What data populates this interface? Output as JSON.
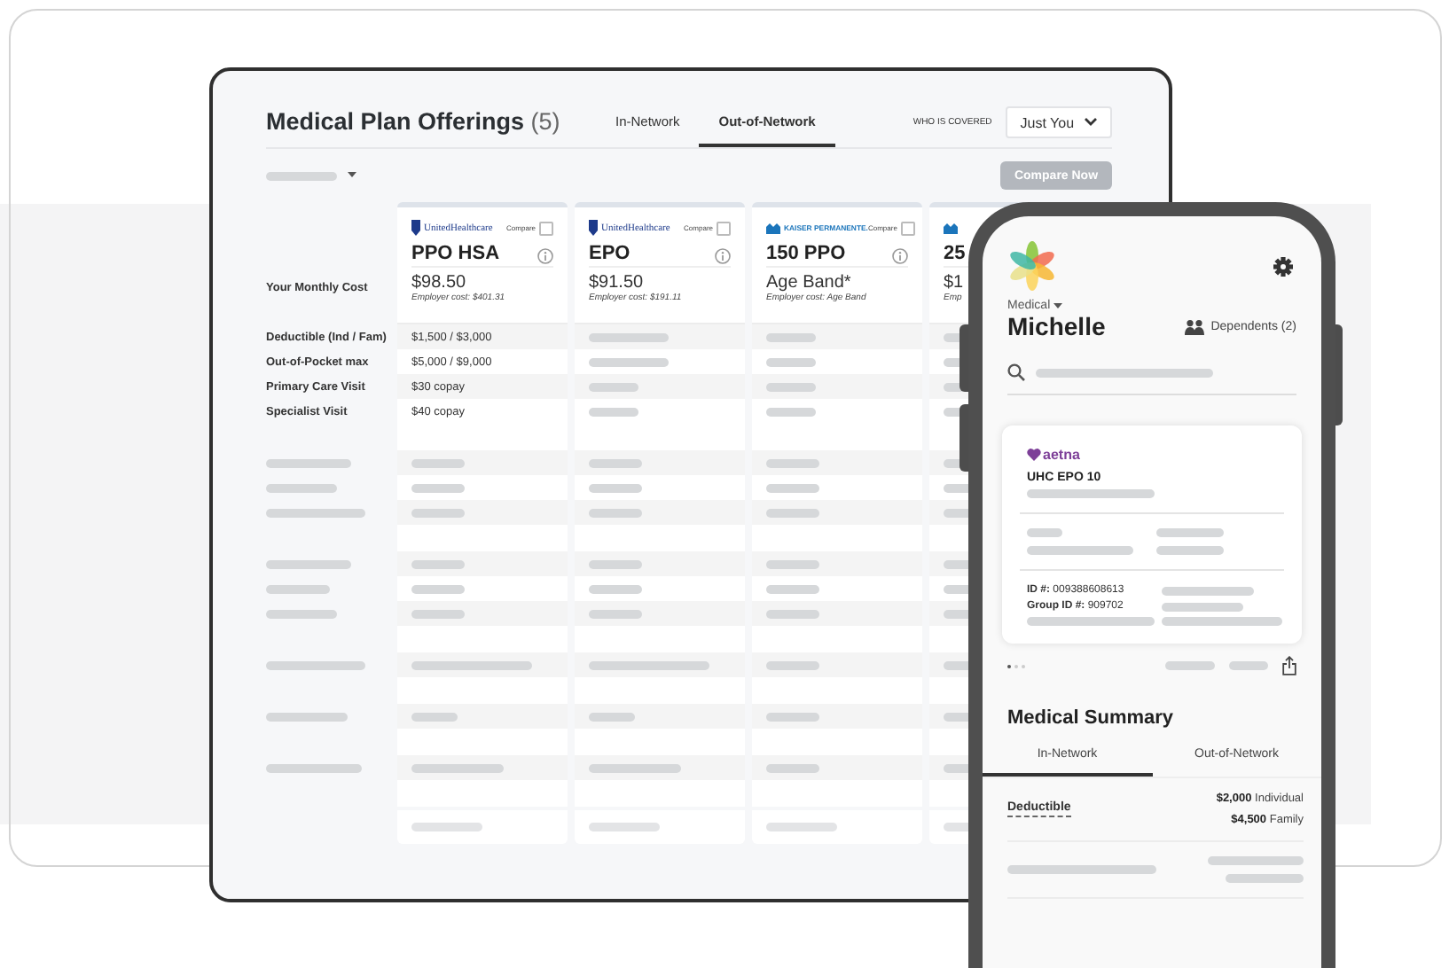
{
  "tablet": {
    "title": "Medical Plan Offerings",
    "count": "(5)",
    "tabs": [
      {
        "label": "In-Network",
        "selected": false
      },
      {
        "label": "Out-of-Network",
        "selected": true
      }
    ],
    "coverage_label": "WHO IS COVERED",
    "coverage_value": "Just You",
    "compare_button": {
      "label": "Compare Now",
      "disabled": true
    },
    "header_label": "Your Monthly Cost",
    "plans": [
      {
        "logo": {
          "kind": "united",
          "text": "UnitedHealthcare"
        },
        "compare_label": "Compare",
        "compare_checked": false,
        "name": "PPO HSA",
        "cost": "$98.50",
        "employer_cost": "Employer cost: $401.31"
      },
      {
        "logo": {
          "kind": "united",
          "text": "UnitedHealthcare"
        },
        "compare_label": "Compare",
        "compare_checked": false,
        "name": "EPO",
        "cost": "$91.50",
        "employer_cost": "Employer cost: $191.11"
      },
      {
        "logo": {
          "kind": "kaiser",
          "text": "KAISER PERMANENTE."
        },
        "compare_label": "Compare",
        "compare_checked": false,
        "name": "150 PPO",
        "cost": "Age Band*",
        "employer_cost": "Employer cost: Age Band"
      },
      {
        "logo": {
          "kind": "kaiser"
        },
        "name": "25",
        "cost": "$1",
        "employer_cost": "Emp"
      }
    ],
    "rows": [
      {
        "kind": "text",
        "label": "Deductible (Ind / Fam)",
        "values": [
          "$1,500 / $3,000"
        ]
      },
      {
        "kind": "text",
        "label": "Out-of-Pocket max",
        "values": [
          "$5,000 / $9,000"
        ]
      },
      {
        "kind": "text",
        "label": "Primary Care Visit",
        "values": [
          "$30 copay"
        ]
      },
      {
        "kind": "text",
        "label": "Specialist Visit",
        "values": [
          "$40 copay"
        ]
      },
      {
        "kind": "blank"
      },
      {
        "kind": "skeleton"
      },
      {
        "kind": "skeleton"
      },
      {
        "kind": "skeleton"
      },
      {
        "kind": "blank"
      },
      {
        "kind": "skeleton"
      },
      {
        "kind": "skeleton"
      },
      {
        "kind": "skeleton"
      },
      {
        "kind": "blank"
      },
      {
        "kind": "skeleton"
      },
      {
        "kind": "blank"
      },
      {
        "kind": "skeleton"
      },
      {
        "kind": "blank"
      },
      {
        "kind": "skeleton"
      },
      {
        "kind": "blank"
      },
      {
        "kind": "footer"
      }
    ]
  },
  "phone": {
    "menu": "Medical",
    "user": "Michelle",
    "dependents": "Dependents (2)",
    "card": {
      "insurer": "aetna",
      "plan": "UHC EPO 10",
      "id": "**ID #:** 009388608613",
      "group_id": "**Group ID #:** 909702"
    },
    "page_dots": [
      {
        "selected": true
      },
      {
        "selected": false
      },
      {
        "selected": false
      }
    ],
    "summary_title": "Medical Summary",
    "tabs": [
      {
        "label": "In-Network",
        "selected": true
      },
      {
        "label": "Out-of-Network",
        "selected": false
      }
    ],
    "rows": [
      {
        "kind": "text",
        "label": "Deductible",
        "values": [
          "**$2,000** Individual",
          "**$4,500** Family"
        ]
      },
      {
        "kind": "skeleton"
      }
    ]
  }
}
